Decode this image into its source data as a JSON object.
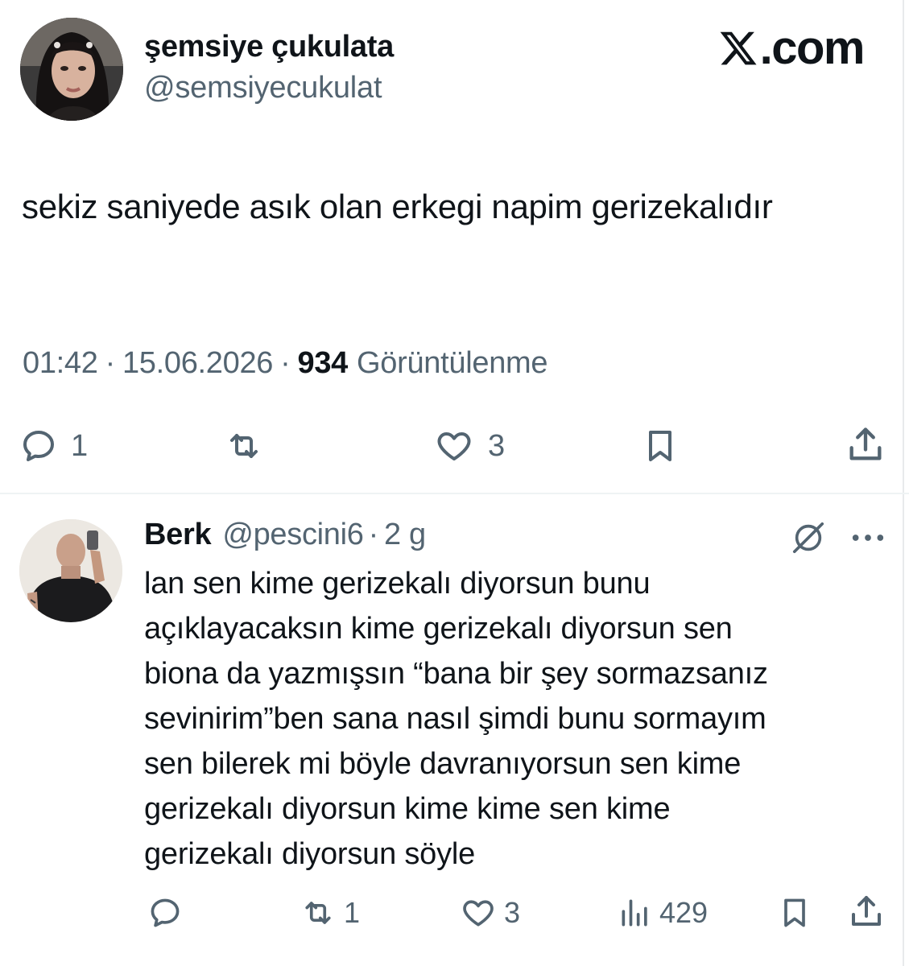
{
  "tweet": {
    "author_name": "şemsiye çukulata",
    "author_handle": "@semsiyecukulat",
    "text": "sekiz saniyede asık olan erkegi napim gerizekalıdır",
    "time": "01:42",
    "date": "15.06.2026",
    "separator": "·",
    "views_count": "934",
    "views_label": "Görüntülenme",
    "actions": {
      "reply_count": "1",
      "like_count": "3"
    },
    "icons": [
      "comment-icon",
      "retweet-icon",
      "heart-icon",
      "bookmark-icon",
      "share-icon"
    ]
  },
  "brand": {
    "text": ".com"
  },
  "reply": {
    "author_name": "Berk",
    "author_handle": "@pescini6",
    "separator": "·",
    "time": "2 g",
    "text": "lan sen kime gerizekalı diyorsun bunu\naçıklayacaksın kime gerizekalı diyorsun sen\nbiona da yazmışsın “bana bir şey sormazsanız\nsevinirim”ben sana nasıl şimdi bunu sormayım\nsen bilerek mi böyle davranıyorsun sen kime\ngerizekalı diyorsun kime kime sen kime\ngerizekalı diyorsun söyle",
    "actions": {
      "retweet_count": "1",
      "like_count": "3",
      "views_count": "429"
    },
    "icons": [
      "comment-icon",
      "retweet-icon",
      "heart-icon",
      "views-icon",
      "bookmark-icon",
      "share-icon",
      "grok-icon",
      "more-icon"
    ]
  },
  "colors": {
    "text": "#0f1419",
    "secondary": "#536471",
    "divider": "#eff3f4"
  }
}
